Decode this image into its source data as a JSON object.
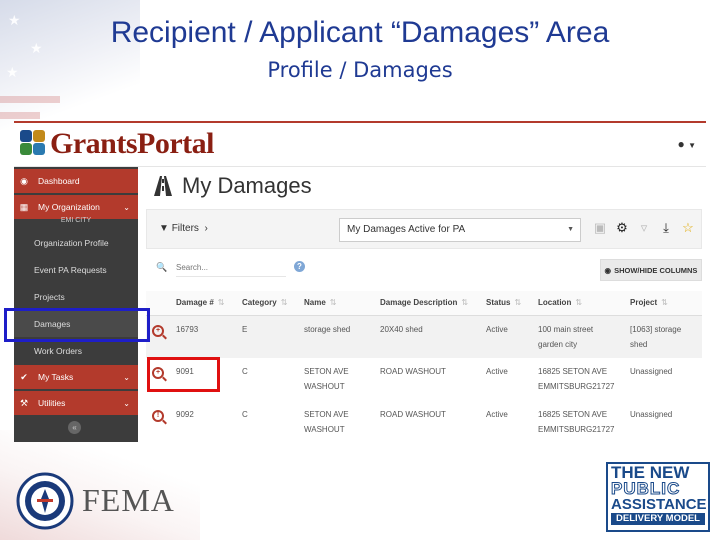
{
  "slide": {
    "title": "Recipient / Applicant “Damages” Area",
    "subtitle": "Profile / Damages"
  },
  "app": {
    "logo_text": "GrantsPortal",
    "page_title": "My Damages",
    "brand_color": "#b33a2c"
  },
  "sidebar": {
    "items": [
      {
        "label": "Dashboard",
        "icon": "palette-icon"
      },
      {
        "label": "My Organization",
        "icon": "building-icon"
      },
      {
        "label": "My Tasks",
        "icon": "check-icon"
      },
      {
        "label": "Utilities",
        "icon": "wrench-icon"
      }
    ],
    "org_name": "EMI CITY",
    "sub_items": [
      {
        "label": "Organization Profile"
      },
      {
        "label": "Event PA Requests"
      },
      {
        "label": "Projects"
      },
      {
        "label": "Damages"
      },
      {
        "label": "Work Orders"
      }
    ]
  },
  "toolbar": {
    "filters_label": "Filters",
    "view_selected": "My Damages Active for PA",
    "icons": [
      "save-icon",
      "gear-icon",
      "filter-clear-icon",
      "download-icon",
      "star-icon"
    ]
  },
  "search": {
    "placeholder": "Search...",
    "show_hide_label": "SHOW/HIDE COLUMNS"
  },
  "table": {
    "columns": [
      "Damage #",
      "Category",
      "Name",
      "Damage Description",
      "Status",
      "Location",
      "Project"
    ],
    "rows": [
      {
        "id": "16793",
        "category": "E",
        "name": "storage shed",
        "description": "20X40 shed",
        "status": "Active",
        "location": "100 main street garden city",
        "project": "[1063] storage shed"
      },
      {
        "id": "9091",
        "category": "C",
        "name": "SETON AVE WASHOUT",
        "description": "ROAD WASHOUT",
        "status": "Active",
        "location": "16825 SETON AVE EMMITSBURG21727",
        "project": "Unassigned"
      },
      {
        "id": "9092",
        "category": "C",
        "name": "SETON AVE WASHOUT",
        "description": "ROAD WASHOUT",
        "status": "Active",
        "location": "16825 SETON AVE EMMITSBURG21727",
        "project": "Unassigned"
      }
    ]
  },
  "footer": {
    "fema_text": "FEMA",
    "pa_logo": {
      "line1": "THE NEW",
      "line2": "PUBLIC",
      "line3": "ASSISTANCE",
      "line4": "DELIVERY MODEL"
    }
  }
}
